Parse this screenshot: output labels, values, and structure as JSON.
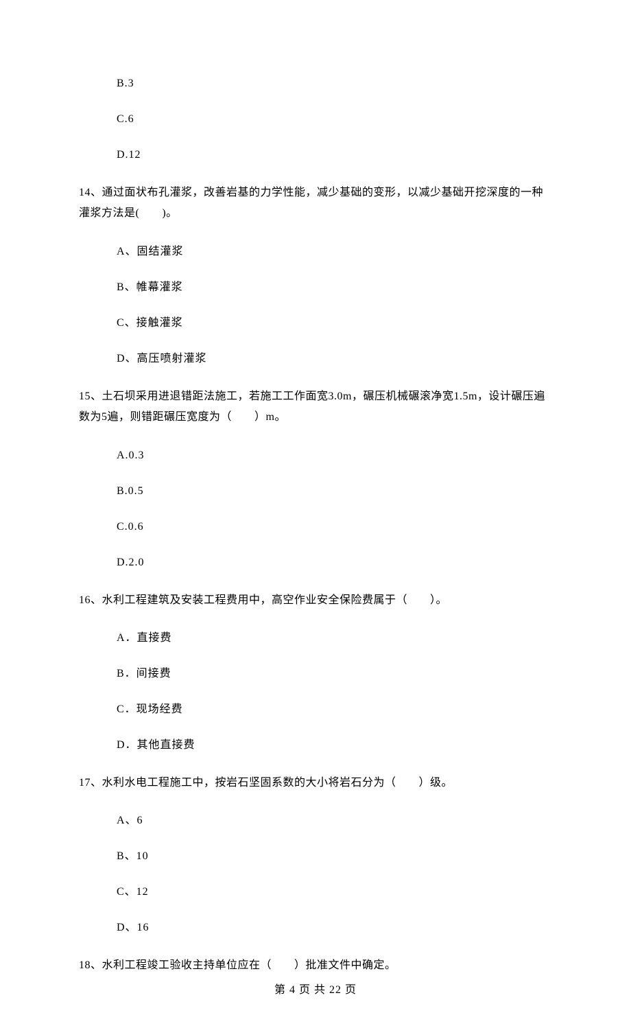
{
  "q13": {
    "options": {
      "b": "B.3",
      "c": "C.6",
      "d": "D.12"
    }
  },
  "q14": {
    "text": "14、通过面状布孔灌浆，改善岩基的力学性能，减少基础的变形，以减少基础开挖深度的一种灌浆方法是(　　)。",
    "options": {
      "a": "A、固结灌浆",
      "b": "B、帷幕灌浆",
      "c": "C、接触灌浆",
      "d": "D、高压喷射灌浆"
    }
  },
  "q15": {
    "text": "15、土石坝采用进退错距法施工，若施工工作面宽3.0m，碾压机械碾滚净宽1.5m，设计碾压遍数为5遍，则错距碾压宽度为（　　）m。",
    "options": {
      "a": "A.0.3",
      "b": "B.0.5",
      "c": "C.0.6",
      "d": "D.2.0"
    }
  },
  "q16": {
    "text": "16、水利工程建筑及安装工程费用中，高空作业安全保险费属于（　　）。",
    "options": {
      "a": "A．直接费",
      "b": "B．间接费",
      "c": "C．现场经费",
      "d": "D．其他直接费"
    }
  },
  "q17": {
    "text": "17、水利水电工程施工中，按岩石坚固系数的大小将岩石分为（　　）级。",
    "options": {
      "a": "A、6",
      "b": "B、10",
      "c": "C、12",
      "d": "D、16"
    }
  },
  "q18": {
    "text": "18、水利工程竣工验收主持单位应在（　　）批准文件中确定。"
  },
  "footer": "第 4 页 共 22 页"
}
